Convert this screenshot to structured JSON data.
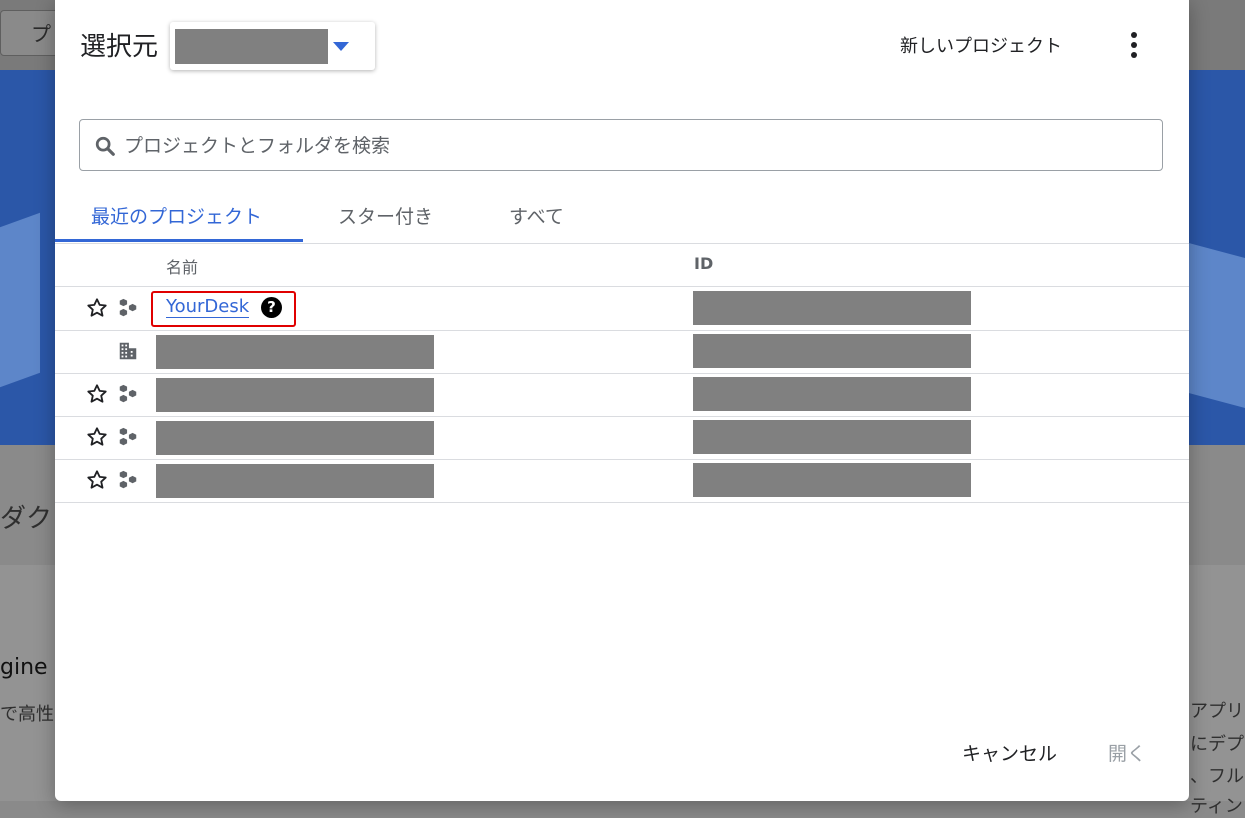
{
  "background": {
    "top_button_text": "プ",
    "side_text_left_1": "ダクト",
    "side_text_left_2": "gine",
    "side_text_left_3": "で高性",
    "side_text_right_1": "アプリ",
    "side_text_right_2": "にデプ",
    "side_text_right_3": "、フル",
    "side_text_right_4": "ティン"
  },
  "dialog": {
    "select_from_label": "選択元",
    "new_project_label": "新しいプロジェクト",
    "more_icon": "more-vert-icon"
  },
  "search": {
    "placeholder": "プロジェクトとフォルダを検索",
    "value": "",
    "icon": "search-icon"
  },
  "tabs": [
    {
      "label": "最近のプロジェクト",
      "active": true
    },
    {
      "label": "スター付き",
      "active": false
    },
    {
      "label": "すべて",
      "active": false
    }
  ],
  "table": {
    "columns": {
      "name": "名前",
      "id": "ID"
    },
    "rows": [
      {
        "type": "project",
        "name": "YourDesk",
        "help": "?",
        "starred": false
      },
      {
        "type": "organization",
        "name": "",
        "starred": null
      },
      {
        "type": "project",
        "name": "",
        "starred": false
      },
      {
        "type": "project",
        "name": "",
        "starred": false
      },
      {
        "type": "project",
        "name": "",
        "starred": false
      }
    ]
  },
  "footer": {
    "cancel_label": "キャンセル",
    "open_label": "開く"
  },
  "colors": {
    "accent": "#3367d6",
    "highlight": "#e00000",
    "redaction": "#808080"
  }
}
